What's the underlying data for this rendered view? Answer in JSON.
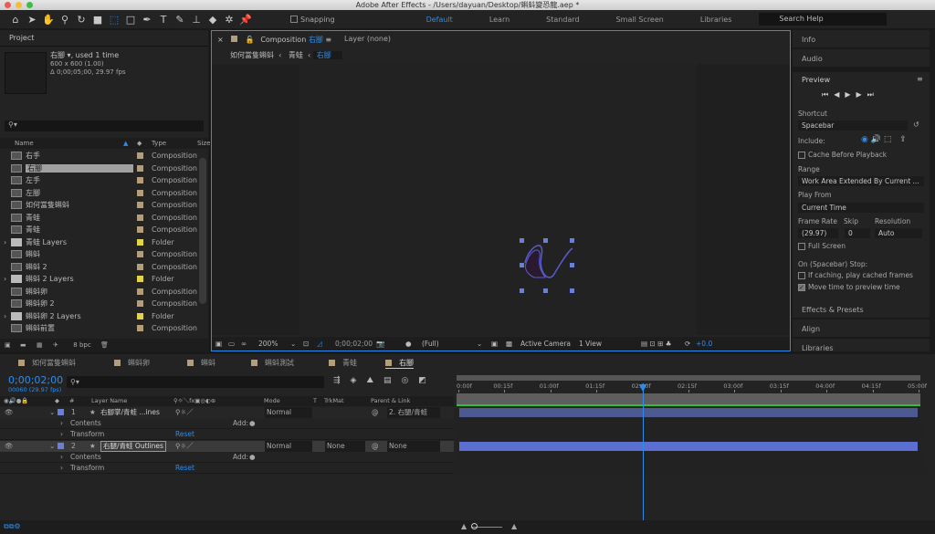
{
  "window": {
    "title": "Adobe After Effects - /Users/dayuan/Desktop/蝌蚪變恐龍.aep *"
  },
  "toolbar": {
    "tools": [
      "home-icon",
      "selection-icon",
      "hand-icon",
      "zoom-icon",
      "rotate-icon",
      "camera-icon",
      "pan-behind-icon",
      "rectangle-icon",
      "pen-icon",
      "type-icon",
      "brush-icon",
      "clone-stamp-icon",
      "eraser-icon",
      "roto-brush-icon",
      "puppet-pin-icon"
    ],
    "snapping": "Snapping",
    "workspaces": [
      "Default",
      "Learn",
      "Standard",
      "Small Screen",
      "Libraries"
    ],
    "active_workspace": "Default",
    "search_placeholder": "Search Help"
  },
  "project": {
    "title": "Project",
    "selected_name": "右腳",
    "used": ", used 1 time",
    "dims": "600 x 600 (1.00)",
    "duration": "Δ 0;00;05;00, 29.97 fps",
    "columns": {
      "name": "Name",
      "type": "Type",
      "size": "Size"
    },
    "items": [
      {
        "name": "右手",
        "type": "Composition",
        "kind": "comp"
      },
      {
        "name": "右腳",
        "type": "Composition",
        "kind": "comp",
        "selected": true
      },
      {
        "name": "左手",
        "type": "Composition",
        "kind": "comp"
      },
      {
        "name": "左腳",
        "type": "Composition",
        "kind": "comp"
      },
      {
        "name": "如何當隻蝌蚪",
        "type": "Composition",
        "kind": "comp"
      },
      {
        "name": "青蛙",
        "type": "Composition",
        "kind": "comp"
      },
      {
        "name": "青蛙",
        "type": "Composition",
        "kind": "comp"
      },
      {
        "name": "青蛙 Layers",
        "type": "Folder",
        "kind": "folder"
      },
      {
        "name": "蝌蚪",
        "type": "Composition",
        "kind": "comp"
      },
      {
        "name": "蝌蚪 2",
        "type": "Composition",
        "kind": "comp"
      },
      {
        "name": "蝌蚪 2 Layers",
        "type": "Folder",
        "kind": "folder"
      },
      {
        "name": "蝌蚪卵",
        "type": "Composition",
        "kind": "comp"
      },
      {
        "name": "蝌蚪卵 2",
        "type": "Composition",
        "kind": "comp"
      },
      {
        "name": "蝌蚪卵 2 Layers",
        "type": "Folder",
        "kind": "folder"
      },
      {
        "name": "蝌蚪前置",
        "type": "Composition",
        "kind": "comp"
      }
    ],
    "bpc": "8 bpc"
  },
  "composition": {
    "tab": "Composition",
    "comp_name": "右腳",
    "layer_tab": "Layer (none)",
    "breadcrumbs": [
      "如何當隻蝌蚪",
      "青蛙",
      "右腳"
    ],
    "footer": {
      "zoom": "200%",
      "time": "0;00;02;00",
      "resolution": "(Full)",
      "camera": "Active Camera",
      "views": "1 View",
      "exposure": "+0.0"
    }
  },
  "right_panel": {
    "info": "Info",
    "audio": "Audio",
    "preview": "Preview",
    "shortcut_label": "Shortcut",
    "shortcut": "Spacebar",
    "include": "Include:",
    "cache_before": "Cache Before Playback",
    "range_label": "Range",
    "range": "Work Area Extended By Current ...",
    "play_from_label": "Play From",
    "play_from": "Current Time",
    "frame_rate_label": "Frame Rate",
    "frame_rate": "(29.97)",
    "skip_label": "Skip",
    "skip": "0",
    "resolution_label": "Resolution",
    "resolution": "Auto",
    "full_screen": "Full Screen",
    "stop_label": "On (Spacebar) Stop:",
    "if_caching": "If caching, play cached frames",
    "move_time": "Move time to preview time",
    "move_time_checked": true,
    "effects": "Effects & Presets",
    "align": "Align",
    "libraries": "Libraries"
  },
  "timeline": {
    "tabs": [
      "如何當隻蝌蚪",
      "蝌蚪卵",
      "蝌蚪",
      "蝌蚪測試",
      "青蛙",
      "右腳"
    ],
    "active_tab": "右腳",
    "timecode": "0;00;02;00",
    "frames": "00060 (29.97 fps)",
    "columns": {
      "num": "#",
      "layer_name": "Layer Name",
      "mode": "Mode",
      "t": "T",
      "trkmat": "TrkMat",
      "parent": "Parent & Link"
    },
    "layers": [
      {
        "num": "1",
        "name": "右腳掌/青蛙 ...ines",
        "mode": "Normal",
        "trkmat": "",
        "parent": "2. 右腿/青蛙",
        "contents": "Contents",
        "transform": "Transform",
        "add": "Add:",
        "reset": "Reset"
      },
      {
        "num": "2",
        "name": "右腿/青蛙 Outlines",
        "mode": "Normal",
        "trkmat": "None",
        "parent": "None",
        "contents": "Contents",
        "transform": "Transform",
        "add": "Add:",
        "reset": "Reset"
      }
    ],
    "ruler": [
      "0:00f",
      "00:15f",
      "01:00f",
      "01:15f",
      "02:00f",
      "02:15f",
      "03:00f",
      "03:15f",
      "04:00f",
      "04:15f",
      "05:00f"
    ],
    "current_time_seconds": 2,
    "duration_seconds": 5,
    "layer_color": "#6a7fd8",
    "accent": "#2d8ceb"
  }
}
